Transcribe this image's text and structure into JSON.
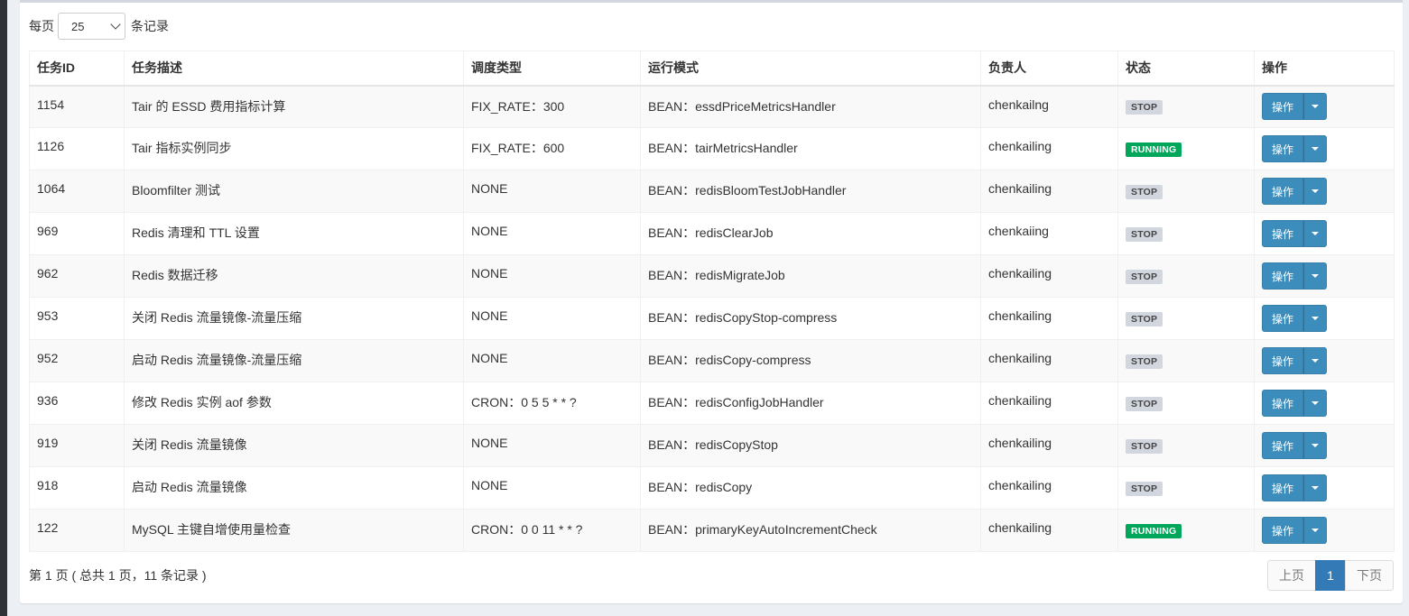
{
  "length_menu": {
    "prefix": "每页",
    "value": "25",
    "suffix": "条记录"
  },
  "table": {
    "headers": [
      "任务ID",
      "任务描述",
      "调度类型",
      "运行模式",
      "负责人",
      "状态",
      "操作"
    ],
    "rows": [
      {
        "id": "1154",
        "desc": "Tair 的 ESSD 费用指标计算",
        "schedule": "FIX_RATE：300",
        "mode": "BEAN：essdPriceMetricsHandler",
        "owner": "chenkailng",
        "status": "STOP"
      },
      {
        "id": "1126",
        "desc": "Tair 指标实例同步",
        "schedule": "FIX_RATE：600",
        "mode": "BEAN：tairMetricsHandler",
        "owner": "chenkailing",
        "status": "RUNNING"
      },
      {
        "id": "1064",
        "desc": "Bloomfilter 测试",
        "schedule": "NONE",
        "mode": "BEAN：redisBloomTestJobHandler",
        "owner": "chenkailing",
        "status": "STOP"
      },
      {
        "id": "969",
        "desc": "Redis 清理和 TTL 设置",
        "schedule": "NONE",
        "mode": "BEAN：redisClearJob",
        "owner": "chenkaiing",
        "status": "STOP"
      },
      {
        "id": "962",
        "desc": "Redis 数据迁移",
        "schedule": "NONE",
        "mode": "BEAN：redisMigrateJob",
        "owner": "chenkailing",
        "status": "STOP"
      },
      {
        "id": "953",
        "desc": "关闭 Redis 流量镜像-流量压缩",
        "schedule": "NONE",
        "mode": "BEAN：redisCopyStop-compress",
        "owner": "chenkailing",
        "status": "STOP"
      },
      {
        "id": "952",
        "desc": "启动 Redis 流量镜像-流量压缩",
        "schedule": "NONE",
        "mode": "BEAN：redisCopy-compress",
        "owner": "chenkailing",
        "status": "STOP"
      },
      {
        "id": "936",
        "desc": "修改 Redis 实例 aof 参数",
        "schedule": "CRON：0 5 5 * * ?",
        "mode": "BEAN：redisConfigJobHandler",
        "owner": "chenkailing",
        "status": "STOP"
      },
      {
        "id": "919",
        "desc": "关闭 Redis 流量镜像",
        "schedule": "NONE",
        "mode": "BEAN：redisCopyStop",
        "owner": "chenkailing",
        "status": "STOP"
      },
      {
        "id": "918",
        "desc": "启动 Redis 流量镜像",
        "schedule": "NONE",
        "mode": "BEAN：redisCopy",
        "owner": "chenkailing",
        "status": "STOP"
      },
      {
        "id": "122",
        "desc": "MySQL 主键自增使用量检查",
        "schedule": "CRON：0 0 11 * * ?",
        "mode": "BEAN：primaryKeyAutoIncrementCheck",
        "owner": "chenkailing",
        "status": "RUNNING"
      }
    ],
    "action_label": "操作"
  },
  "footer": {
    "info": "第 1 页 ( 总共 1 页，11 条记录 )",
    "prev": "上页",
    "current": "1",
    "next": "下页"
  },
  "colors": {
    "primary": "#3c8dbc",
    "running": "#00a65a",
    "stop": "#d2d6de",
    "page_active": "#337ab7"
  }
}
